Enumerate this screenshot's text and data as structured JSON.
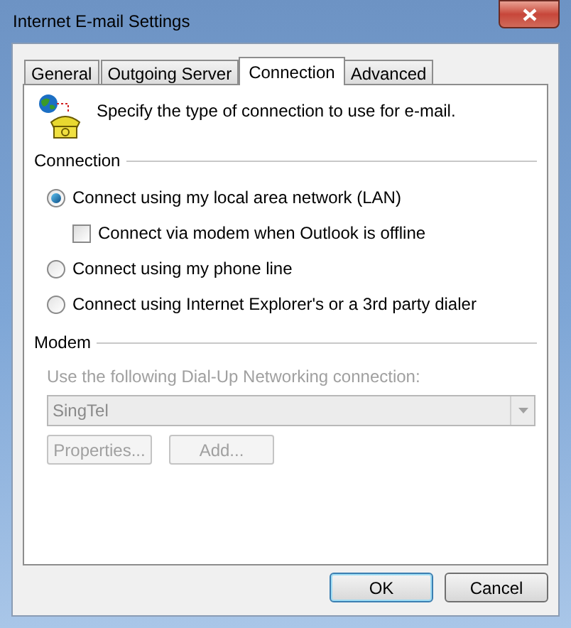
{
  "window": {
    "title": "Internet E-mail Settings"
  },
  "tabs": [
    {
      "label": "General",
      "selected": false
    },
    {
      "label": "Outgoing Server",
      "selected": false
    },
    {
      "label": "Connection",
      "selected": true
    },
    {
      "label": "Advanced",
      "selected": false
    }
  ],
  "intro": "Specify the type of connection to use for e-mail.",
  "connection": {
    "label": "Connection",
    "options": [
      {
        "kind": "radio",
        "label": "Connect using my local area network (LAN)",
        "selected": true,
        "children": [
          {
            "kind": "checkbox",
            "label": "Connect via modem when Outlook is offline",
            "checked": false
          }
        ]
      },
      {
        "kind": "radio",
        "label": "Connect using my phone line",
        "selected": false
      },
      {
        "kind": "radio",
        "label": "Connect using Internet Explorer's or a 3rd party dialer",
        "selected": false
      }
    ]
  },
  "modem": {
    "label": "Modem",
    "disabled": true,
    "field_label": "Use the following Dial-Up Networking connection:",
    "value": "SingTel",
    "buttons": [
      "Properties...",
      "Add..."
    ]
  },
  "buttons": [
    {
      "label": "OK",
      "default": true
    },
    {
      "label": "Cancel",
      "default": false
    }
  ]
}
